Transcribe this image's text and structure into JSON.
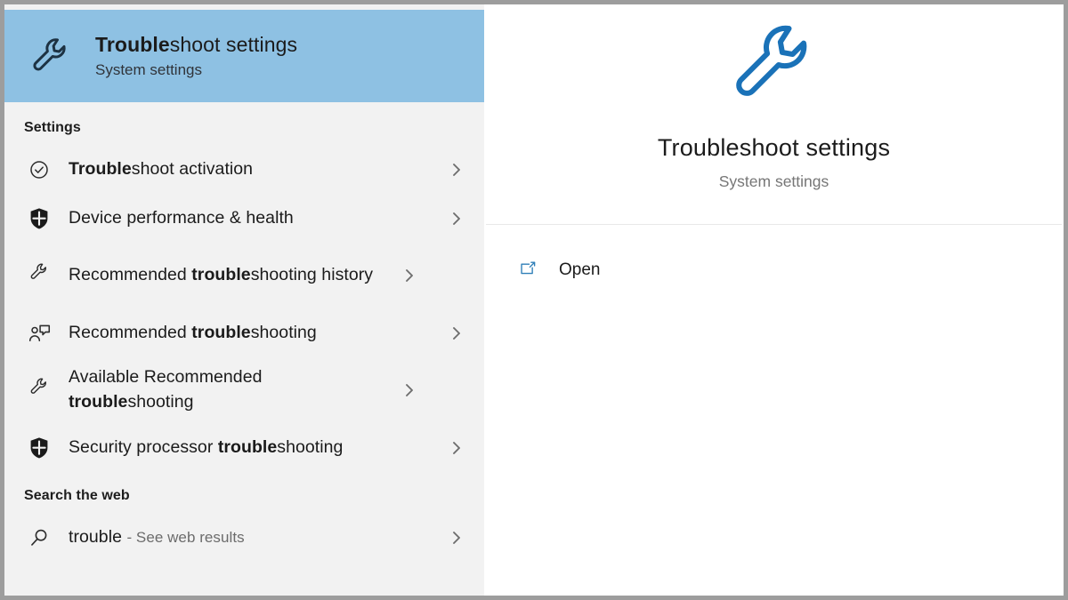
{
  "best_match": {
    "icon": "wrench-icon",
    "title_bold": "Trouble",
    "title_rest": "shoot settings",
    "subtitle": "System settings"
  },
  "sections": [
    {
      "header": "Settings"
    },
    {
      "header": "Search the web"
    }
  ],
  "settings_section": {
    "header": "Settings",
    "items": [
      {
        "icon": "check-circle-icon",
        "pre": "",
        "bold": "Trouble",
        "post": "shoot activation",
        "chevron": "chevron-right-icon"
      },
      {
        "icon": "shield-icon",
        "pre": "Device performance & health",
        "bold": "",
        "post": "",
        "chevron": "chevron-right-icon"
      },
      {
        "icon": "wrench-icon",
        "pre": "Recommended ",
        "bold": "trouble",
        "post": "shooting history",
        "chevron": "chevron-right-icon"
      },
      {
        "icon": "person-feedback-icon",
        "pre": "Recommended ",
        "bold": "trouble",
        "post": "shooting",
        "chevron": "chevron-right-icon"
      },
      {
        "icon": "wrench-icon",
        "pre": "Available Recommended ",
        "bold": "trouble",
        "post": "shooting",
        "chevron": "chevron-right-icon"
      },
      {
        "icon": "shield-icon",
        "pre": "Security processor ",
        "bold": "trouble",
        "post": "shooting",
        "chevron": "chevron-right-icon"
      }
    ]
  },
  "web_section": {
    "header": "Search the web",
    "items": [
      {
        "icon": "search-icon",
        "query": "trouble",
        "suffix": "- See web results",
        "chevron": "chevron-right-icon"
      }
    ]
  },
  "preview": {
    "icon": "wrench-icon",
    "title": "Troubleshoot settings",
    "subtitle": "System settings",
    "actions": [
      {
        "icon": "open-external-icon",
        "label": "Open"
      }
    ]
  },
  "colors": {
    "selection_blue": "#8ec1e3",
    "accent_blue": "#1a72b8",
    "pane_background": "#f2f2f2",
    "preview_background": "#ffffff",
    "text_primary": "#1b1b1b",
    "text_secondary": "#767676",
    "frame_gray": "#9d9d9d"
  }
}
